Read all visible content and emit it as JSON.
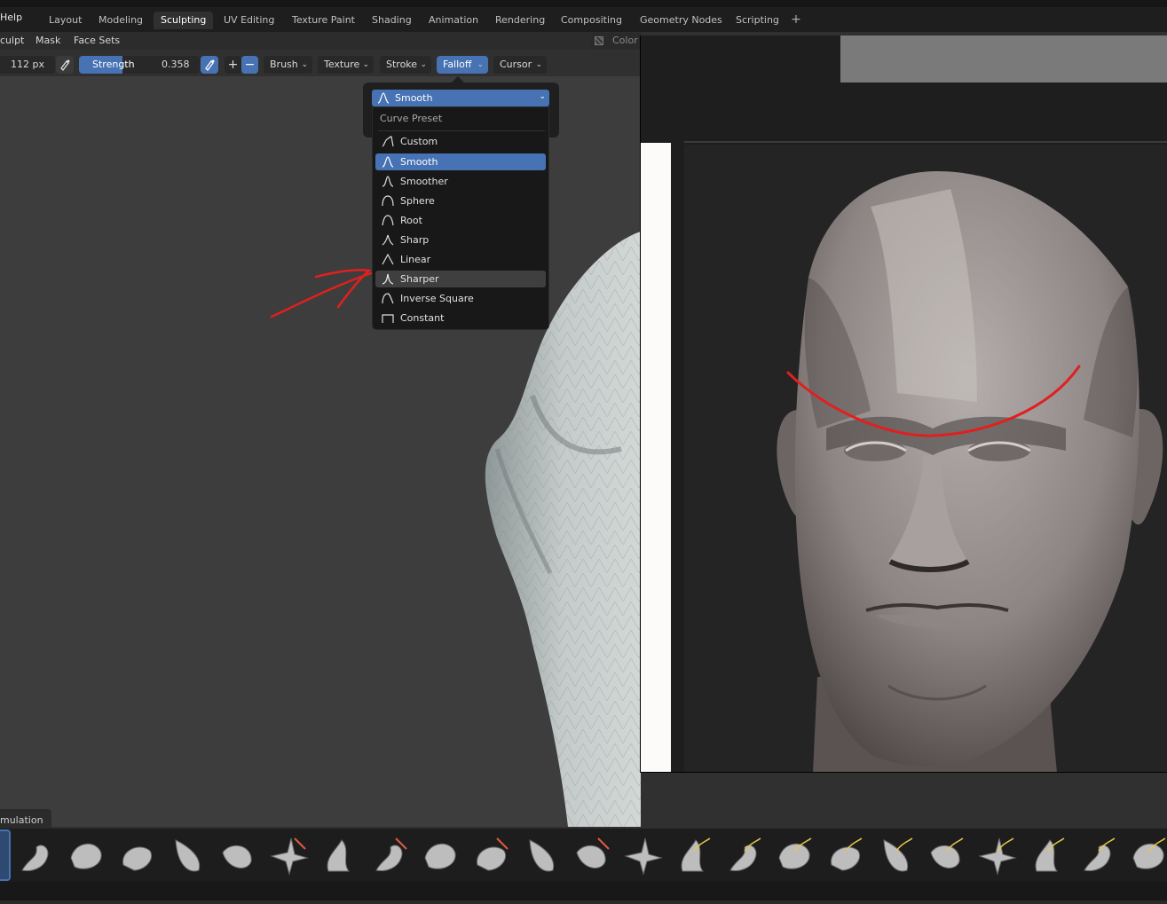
{
  "menubar": {
    "help": "Help",
    "tabs": [
      {
        "label": "Layout",
        "active": false
      },
      {
        "label": "Modeling",
        "active": false
      },
      {
        "label": "Sculpting",
        "active": true
      },
      {
        "label": "UV Editing",
        "active": false
      },
      {
        "label": "Texture Paint",
        "active": false
      },
      {
        "label": "Shading",
        "active": false
      },
      {
        "label": "Animation",
        "active": false
      },
      {
        "label": "Rendering",
        "active": false
      },
      {
        "label": "Compositing",
        "active": false
      },
      {
        "label": "Geometry Nodes",
        "active": false
      },
      {
        "label": "Scripting",
        "active": false
      }
    ],
    "add_tab": "+"
  },
  "header": {
    "sculpt": "culpt",
    "mask": "Mask",
    "face_sets": "Face Sets",
    "color": "Color"
  },
  "toolbar": {
    "radius": "112 px",
    "strength_label": "Strength",
    "strength_value": "0.358",
    "strength_fraction": 0.358,
    "add": "+",
    "subtract": "−",
    "brush": "Brush",
    "texture": "Texture",
    "stroke": "Stroke",
    "falloff": "Falloff",
    "cursor": "Cursor"
  },
  "falloff_popover": {
    "selected_preset": "Smooth",
    "menu_title": "Curve Preset",
    "items": [
      {
        "label": "Custom",
        "icon": "curve-custom-icon",
        "state": ""
      },
      {
        "label": "Smooth",
        "icon": "curve-smooth-icon",
        "state": "selected"
      },
      {
        "label": "Smoother",
        "icon": "curve-smoother-icon",
        "state": ""
      },
      {
        "label": "Sphere",
        "icon": "curve-sphere-icon",
        "state": ""
      },
      {
        "label": "Root",
        "icon": "curve-root-icon",
        "state": ""
      },
      {
        "label": "Sharp",
        "icon": "curve-sharp-icon",
        "state": ""
      },
      {
        "label": "Linear",
        "icon": "curve-linear-icon",
        "state": ""
      },
      {
        "label": "Sharper",
        "icon": "curve-sharper-icon",
        "state": "hovered"
      },
      {
        "label": "Inverse Square",
        "icon": "curve-inverse-square-icon",
        "state": ""
      },
      {
        "label": "Constant",
        "icon": "curve-constant-icon",
        "state": ""
      }
    ]
  },
  "asset_shelf": {
    "tab": "mulation",
    "brushes": [
      "draw",
      "draw-sharp",
      "clay",
      "clay-strips",
      "clay-thumb",
      "layer",
      "inflate",
      "blob",
      "crease",
      "smooth",
      "flatten",
      "fill",
      "scrape",
      "multiplane-scrape",
      "pinch",
      "grab",
      "elastic-deform",
      "snake-hook",
      "thumb",
      "pose",
      "nudge",
      "rotate",
      "slide-relax",
      "boundary",
      "cloth"
    ]
  },
  "colors": {
    "accent": "#4772b3",
    "annotation": "#e0201f",
    "hover": "#3f3f3f"
  }
}
